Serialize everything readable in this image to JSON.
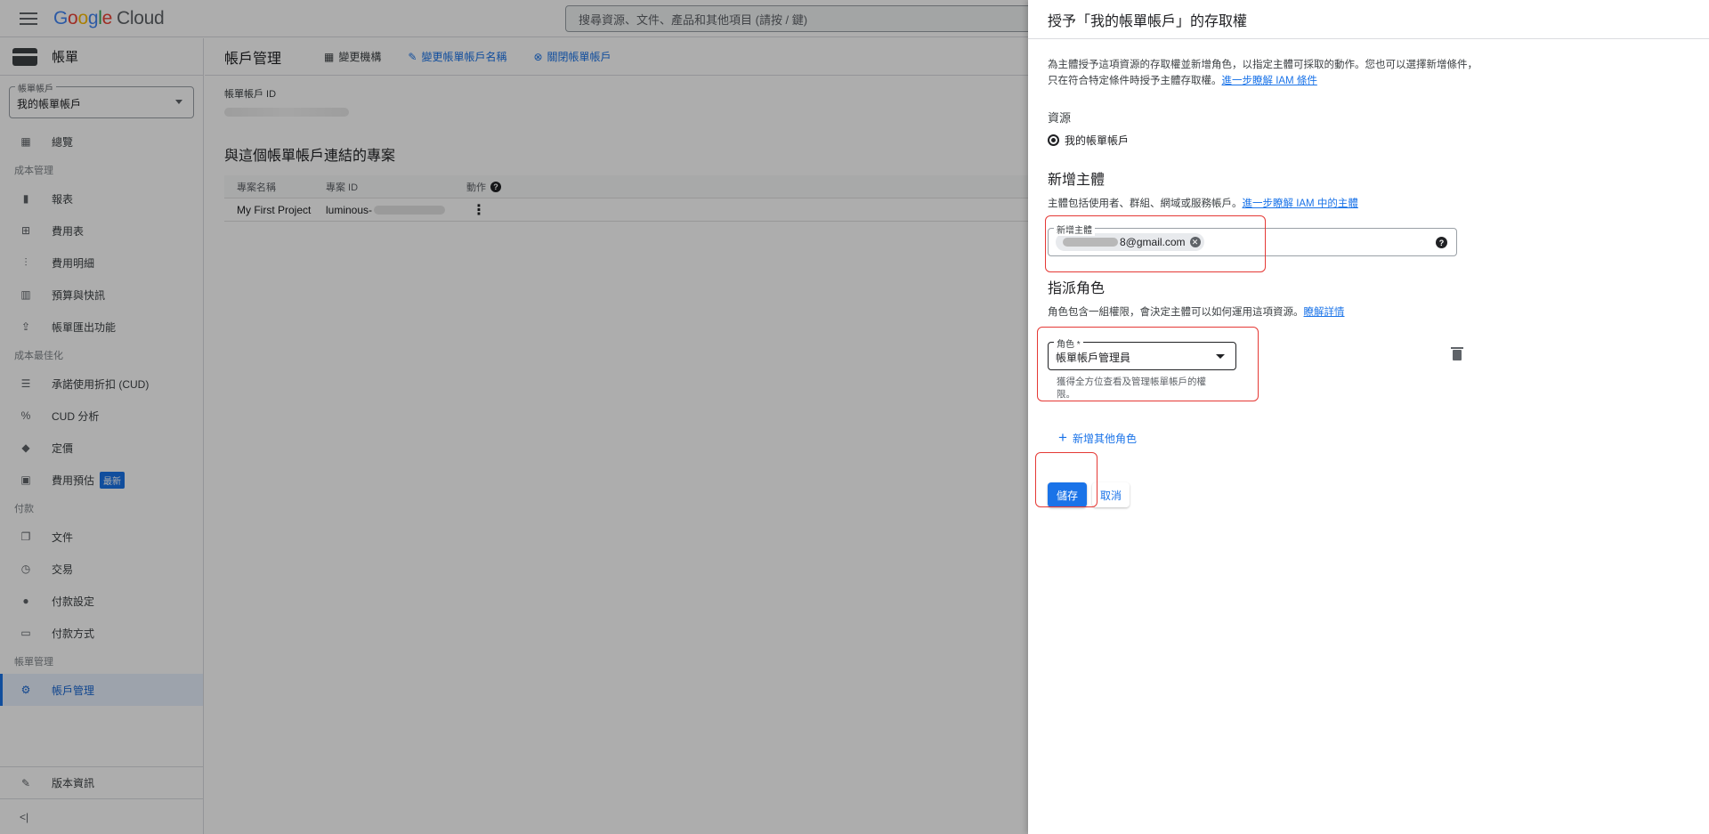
{
  "topbar": {
    "logo_google": [
      "G",
      "o",
      "o",
      "g",
      "l",
      "e"
    ],
    "logo_cloud": "Cloud",
    "search_placeholder": "搜尋資源、文件、產品和其他項目 (請按 / 鍵)"
  },
  "sidebar": {
    "title": "帳單",
    "account_label": "帳單帳戶",
    "account_value": "我的帳單帳戶",
    "sections": {
      "cost_management": "成本管理",
      "cost_optimization": "成本最佳化",
      "payments": "付款",
      "billing_management": "帳單管理"
    },
    "items": {
      "overview": "總覽",
      "reports": "報表",
      "cost_table": "費用表",
      "cost_breakdown": "費用明細",
      "budgets": "預算與快訊",
      "export": "帳單匯出功能",
      "cud": "承諾使用折扣 (CUD)",
      "cud_analysis": "CUD 分析",
      "pricing": "定價",
      "estimate": "費用預估",
      "estimate_badge": "最新",
      "documents": "文件",
      "transactions": "交易",
      "payment_settings": "付款設定",
      "payment_method": "付款方式",
      "account_management": "帳戶管理",
      "release_notes": "版本資訊",
      "collapse": "<|"
    }
  },
  "main": {
    "title": "帳戶管理",
    "toolbar": {
      "change_org": "變更機構",
      "rename": "變更帳單帳戶名稱",
      "close": "關閉帳單帳戶"
    },
    "id_label": "帳單帳戶 ID",
    "projects_title": "與這個帳單帳戶連結的專案",
    "table": {
      "headers": [
        "專案名稱",
        "專案 ID",
        "動作"
      ],
      "rows": [
        {
          "name": "My First Project",
          "id": "luminous-"
        }
      ]
    }
  },
  "panel": {
    "title": "授予「我的帳單帳戶」的存取權",
    "description": "為主體授予這項資源的存取權並新增角色，以指定主體可採取的動作。您也可以選擇新增條件，只在符合特定條件時授予主體存取權。",
    "description_link": "進一步瞭解 IAM 條件",
    "resource_label": "資源",
    "resource_value": "我的帳單帳戶",
    "add_principal_title": "新增主體",
    "add_principal_desc": "主體包括使用者、群組、網域或服務帳戶。",
    "add_principal_link": "進一步瞭解 IAM 中的主體",
    "principal_field_label": "新增主體",
    "principal_chip": "8@gmail.com",
    "assign_role_title": "指派角色",
    "assign_role_desc": "角色包含一組權限，會決定主體可以如何運用這項資源。",
    "assign_role_link": "瞭解詳情",
    "role_field_label": "角色 *",
    "role_value": "帳單帳戶管理員",
    "role_hint": "獲得全方位查看及管理帳單帳戶的權限。",
    "add_role": "新增其他角色",
    "save": "儲存",
    "cancel": "取消"
  },
  "colors": {
    "accent": "#1a73e8",
    "highlight": "#e53935"
  }
}
